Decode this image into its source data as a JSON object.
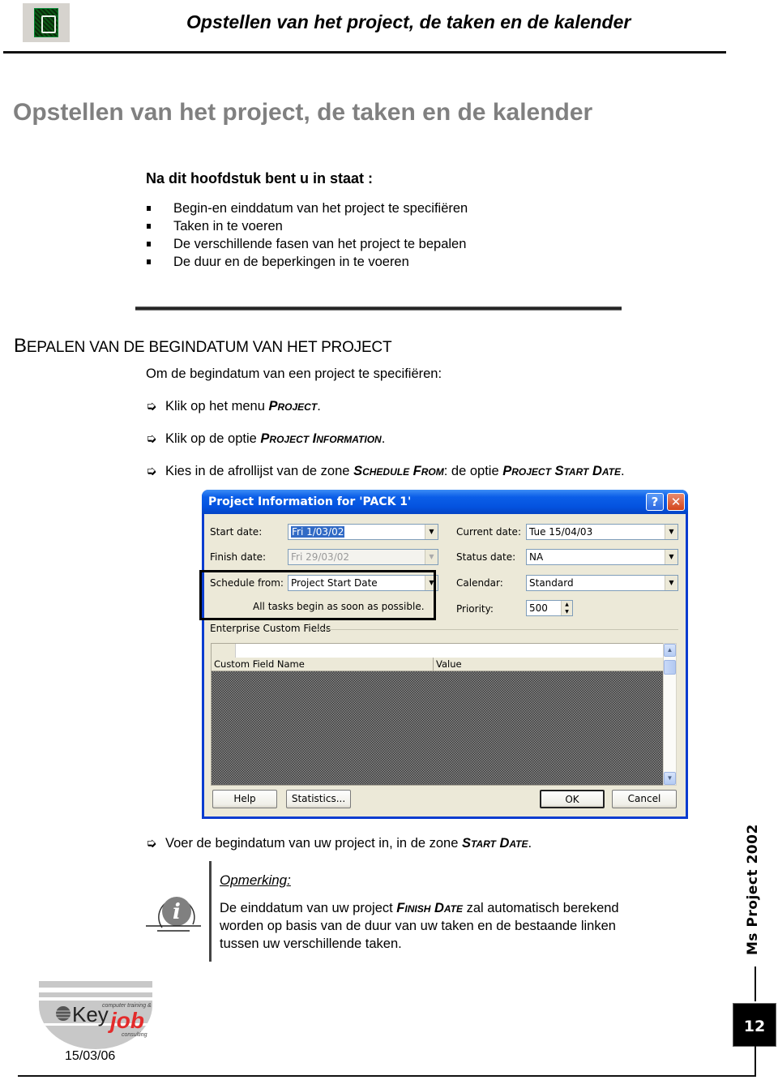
{
  "header": {
    "title": "Opstellen van het project, de taken en de kalender",
    "icon": "ms-project-app-icon"
  },
  "chapter_title": "Opstellen van het project, de taken en de kalender",
  "objectives": {
    "heading": "Na dit hoofdstuk bent u in staat :",
    "items": [
      "Begin-en einddatum van het project te specifiëren",
      "Taken in te voeren",
      "De verschillende fasen van het project te bepalen",
      "De duur en de beperkingen in te voeren"
    ]
  },
  "section": {
    "heading_first": "B",
    "heading_rest": "EPALEN VAN DE BEGINDATUM VAN HET PROJECT",
    "intro": "Om de begindatum van een project te specifiëren:",
    "arrow_icon": "pointing-hand-arrow-icon",
    "steps": [
      {
        "pre": "Klik op het menu ",
        "kw1": "Project",
        "mid": "",
        "kw2": "",
        "post": "."
      },
      {
        "pre": "Klik op de optie ",
        "kw1": "Project Information",
        "mid": "",
        "kw2": "",
        "post": "."
      },
      {
        "pre": "Kies in de afrollijst van de zone ",
        "kw1": "Schedule From",
        "mid": ": de optie ",
        "kw2": "Project Start Date",
        "post": "."
      }
    ],
    "step4": {
      "pre": "Voer de begindatum van uw project in, in de zone ",
      "kw1": "Start Date",
      "post": "."
    }
  },
  "dialog": {
    "title": "Project Information for 'PACK 1'",
    "help_glyph": "?",
    "close_glyph": "✕",
    "left": {
      "start_label": "Start date:",
      "start_value": "Fri 1/03/02",
      "finish_label": "Finish date:",
      "finish_value": "Fri 29/03/02",
      "schedule_label": "Schedule from:",
      "schedule_value": "Project Start Date",
      "schedule_note": "All tasks begin as soon as possible."
    },
    "right": {
      "current_label": "Current date:",
      "current_value": "Tue 15/04/03",
      "status_label": "Status date:",
      "status_value": "NA",
      "calendar_label": "Calendar:",
      "calendar_value": "Standard",
      "priority_label": "Priority:",
      "priority_value": "500"
    },
    "group_label": "Enterprise Custom Fields",
    "grid": {
      "columns": [
        "Custom Field Name",
        "Value"
      ]
    },
    "buttons": {
      "help": "Help",
      "statistics": "Statistics...",
      "ok": "OK",
      "cancel": "Cancel"
    }
  },
  "note": {
    "heading": "Opmerking:",
    "body_pre": "De einddatum van uw project ",
    "body_kw": "Finish Date",
    "body_post": " zal automatisch berekend worden op basis van de duur van uw taken en de bestaande linken tussen uw verschillende taken."
  },
  "sidebar": {
    "product": "Ms Project 2002"
  },
  "footer": {
    "date": "15/03/06",
    "page_number": "12",
    "logo": {
      "brand_key": "Key",
      "brand_job": "job",
      "tagline_top": "computer training &",
      "tagline_bottom": "consulting",
      "accent_color": "#e32b2b"
    }
  }
}
